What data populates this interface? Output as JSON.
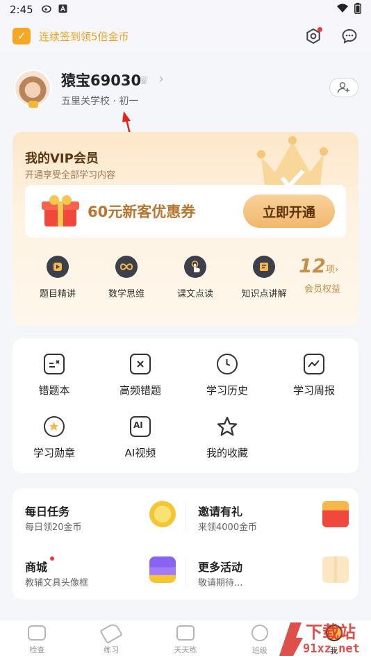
{
  "status_bar": {
    "time": "2:45"
  },
  "top_bar": {
    "checkin_text": "连续签到领5倍金币"
  },
  "profile": {
    "name": "猿宝69030",
    "school": "五里关学校 · 初一"
  },
  "vip": {
    "title": "我的VIP会员",
    "subtitle": "开通享受全部学习内容",
    "coupon_text": "60元新客优惠券",
    "open_button": "立即开通",
    "features": [
      {
        "label": "题目精讲",
        "icon": "play-icon"
      },
      {
        "label": "数学思维",
        "icon": "infinity-icon"
      },
      {
        "label": "课文点读",
        "icon": "finger-tap-icon"
      },
      {
        "label": "知识点讲解",
        "icon": "book-icon"
      }
    ],
    "benefits_count": "12",
    "benefits_unit": "项",
    "benefits_label": "会员权益"
  },
  "tools": [
    {
      "label": "错题本",
      "icon": "wrong-book-icon"
    },
    {
      "label": "高频错题",
      "icon": "frequent-error-icon"
    },
    {
      "label": "学习历史",
      "icon": "history-clock-icon"
    },
    {
      "label": "学习周报",
      "icon": "weekly-report-icon"
    },
    {
      "label": "学习勋章",
      "icon": "medal-icon"
    },
    {
      "label": "AI视频",
      "icon": "ai-video-icon"
    },
    {
      "label": "我的收藏",
      "icon": "star-icon"
    }
  ],
  "tasks": [
    {
      "title": "每日任务",
      "subtitle": "每日领20金币",
      "icon": "gold-coin-icon"
    },
    {
      "title": "邀请有礼",
      "subtitle": "来领4000金币",
      "icon": "red-envelope-icon"
    },
    {
      "title": "商城",
      "subtitle": "教辅文具头像框",
      "icon": "shop-icon"
    },
    {
      "title": "更多活动",
      "subtitle": "敬请期待...",
      "icon": "gift-box-icon"
    }
  ],
  "tabbar": [
    {
      "label": "检查",
      "icon": "camera-icon"
    },
    {
      "label": "练习",
      "icon": "pencil-icon"
    },
    {
      "label": "天天练",
      "icon": "check-calendar-icon"
    },
    {
      "label": "班级",
      "icon": "class-icon"
    },
    {
      "label": "我",
      "icon": "me-icon"
    }
  ],
  "watermark": {
    "text": "下载站",
    "site": "91xz.net"
  },
  "colors": {
    "accent_orange": "#f0a020",
    "vip_gold": "#c49147",
    "red_dot": "#f03a3a"
  }
}
